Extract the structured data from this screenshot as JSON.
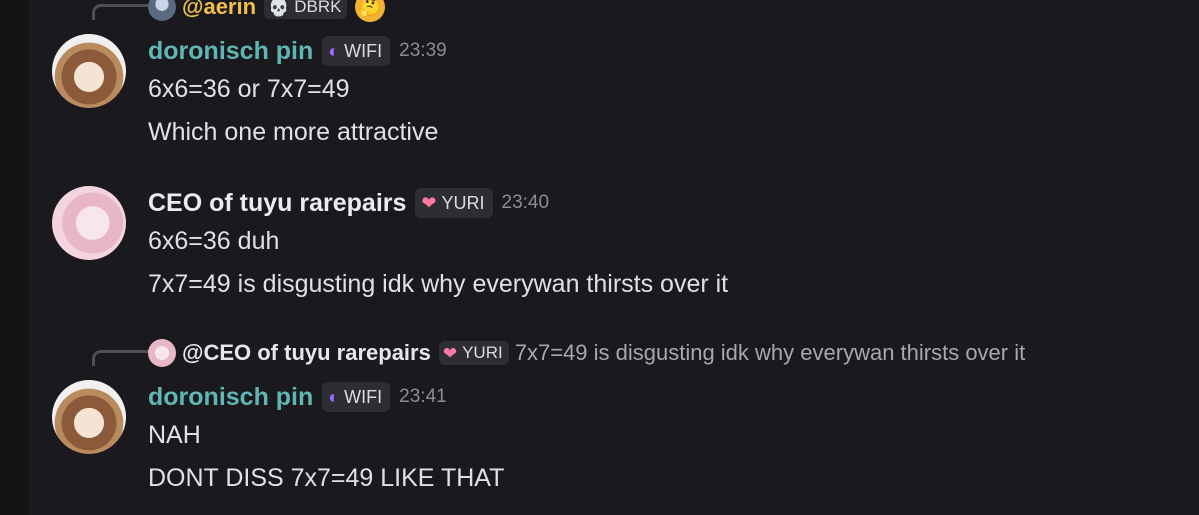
{
  "top_reply": {
    "username": "@aerin",
    "tag": {
      "icon": "skull-icon",
      "label": "DBRK"
    },
    "emoji": "🤔"
  },
  "messages": [
    {
      "author": "doronisch pin",
      "author_color": "#5fb6b3",
      "tag": {
        "icon": "crescent-moon-icon",
        "label": "WIFI"
      },
      "time": "23:39",
      "lines": [
        "6x6=36 or 7x7=49",
        "Which one more attractive"
      ]
    },
    {
      "author": "CEO of tuyu rarepairs",
      "author_color": "#ececef",
      "tag": {
        "icon": "heart-icon",
        "label": "YURI"
      },
      "time": "23:40",
      "lines": [
        "6x6=36  duh",
        "7x7=49  is disgusting idk why everywan thirsts over it"
      ]
    },
    {
      "reply": {
        "username": "@CEO of tuyu rarepairs",
        "tag": {
          "icon": "heart-icon",
          "label": "YURI"
        },
        "text": "7x7=49  is disgusting idk why everywan thirsts over it"
      },
      "author": "doronisch pin",
      "author_color": "#5fb6b3",
      "tag": {
        "icon": "crescent-moon-icon",
        "label": "WIFI"
      },
      "time": "23:41",
      "lines": [
        "NAH",
        "DONT DISS 7x7=49 LIKE THAT"
      ]
    }
  ]
}
